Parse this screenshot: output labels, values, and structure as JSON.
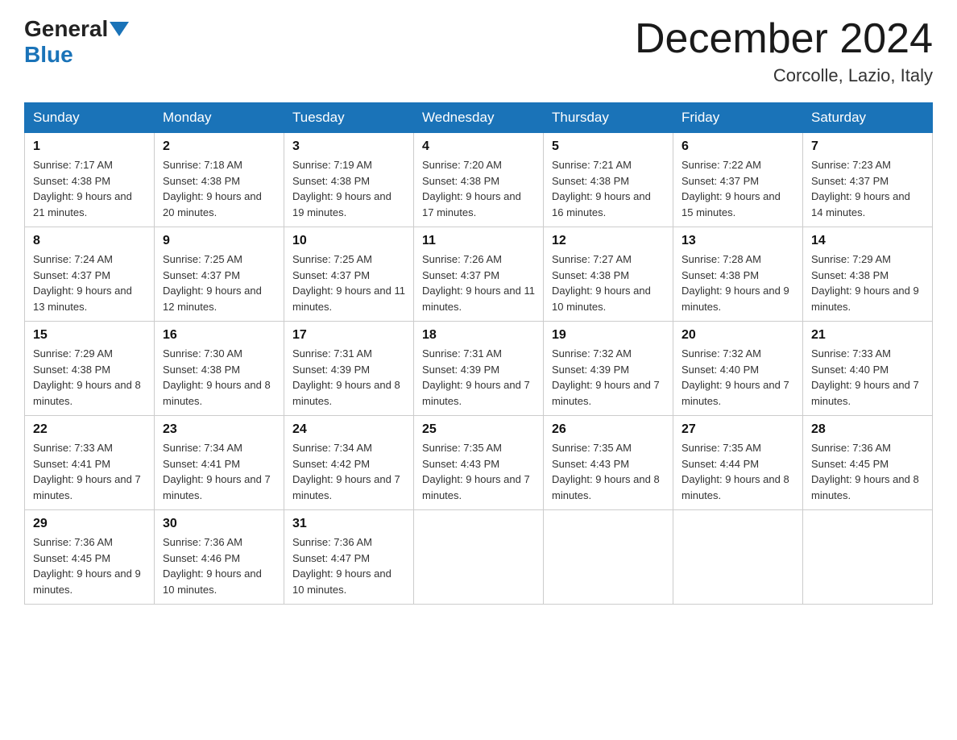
{
  "header": {
    "logo": {
      "general": "General",
      "blue": "Blue"
    },
    "title": "December 2024",
    "location": "Corcolle, Lazio, Italy"
  },
  "days_of_week": [
    "Sunday",
    "Monday",
    "Tuesday",
    "Wednesday",
    "Thursday",
    "Friday",
    "Saturday"
  ],
  "weeks": [
    [
      {
        "day": "1",
        "sunrise": "7:17 AM",
        "sunset": "4:38 PM",
        "daylight": "9 hours and 21 minutes."
      },
      {
        "day": "2",
        "sunrise": "7:18 AM",
        "sunset": "4:38 PM",
        "daylight": "9 hours and 20 minutes."
      },
      {
        "day": "3",
        "sunrise": "7:19 AM",
        "sunset": "4:38 PM",
        "daylight": "9 hours and 19 minutes."
      },
      {
        "day": "4",
        "sunrise": "7:20 AM",
        "sunset": "4:38 PM",
        "daylight": "9 hours and 17 minutes."
      },
      {
        "day": "5",
        "sunrise": "7:21 AM",
        "sunset": "4:38 PM",
        "daylight": "9 hours and 16 minutes."
      },
      {
        "day": "6",
        "sunrise": "7:22 AM",
        "sunset": "4:37 PM",
        "daylight": "9 hours and 15 minutes."
      },
      {
        "day": "7",
        "sunrise": "7:23 AM",
        "sunset": "4:37 PM",
        "daylight": "9 hours and 14 minutes."
      }
    ],
    [
      {
        "day": "8",
        "sunrise": "7:24 AM",
        "sunset": "4:37 PM",
        "daylight": "9 hours and 13 minutes."
      },
      {
        "day": "9",
        "sunrise": "7:25 AM",
        "sunset": "4:37 PM",
        "daylight": "9 hours and 12 minutes."
      },
      {
        "day": "10",
        "sunrise": "7:25 AM",
        "sunset": "4:37 PM",
        "daylight": "9 hours and 11 minutes."
      },
      {
        "day": "11",
        "sunrise": "7:26 AM",
        "sunset": "4:37 PM",
        "daylight": "9 hours and 11 minutes."
      },
      {
        "day": "12",
        "sunrise": "7:27 AM",
        "sunset": "4:38 PM",
        "daylight": "9 hours and 10 minutes."
      },
      {
        "day": "13",
        "sunrise": "7:28 AM",
        "sunset": "4:38 PM",
        "daylight": "9 hours and 9 minutes."
      },
      {
        "day": "14",
        "sunrise": "7:29 AM",
        "sunset": "4:38 PM",
        "daylight": "9 hours and 9 minutes."
      }
    ],
    [
      {
        "day": "15",
        "sunrise": "7:29 AM",
        "sunset": "4:38 PM",
        "daylight": "9 hours and 8 minutes."
      },
      {
        "day": "16",
        "sunrise": "7:30 AM",
        "sunset": "4:38 PM",
        "daylight": "9 hours and 8 minutes."
      },
      {
        "day": "17",
        "sunrise": "7:31 AM",
        "sunset": "4:39 PM",
        "daylight": "9 hours and 8 minutes."
      },
      {
        "day": "18",
        "sunrise": "7:31 AM",
        "sunset": "4:39 PM",
        "daylight": "9 hours and 7 minutes."
      },
      {
        "day": "19",
        "sunrise": "7:32 AM",
        "sunset": "4:39 PM",
        "daylight": "9 hours and 7 minutes."
      },
      {
        "day": "20",
        "sunrise": "7:32 AM",
        "sunset": "4:40 PM",
        "daylight": "9 hours and 7 minutes."
      },
      {
        "day": "21",
        "sunrise": "7:33 AM",
        "sunset": "4:40 PM",
        "daylight": "9 hours and 7 minutes."
      }
    ],
    [
      {
        "day": "22",
        "sunrise": "7:33 AM",
        "sunset": "4:41 PM",
        "daylight": "9 hours and 7 minutes."
      },
      {
        "day": "23",
        "sunrise": "7:34 AM",
        "sunset": "4:41 PM",
        "daylight": "9 hours and 7 minutes."
      },
      {
        "day": "24",
        "sunrise": "7:34 AM",
        "sunset": "4:42 PM",
        "daylight": "9 hours and 7 minutes."
      },
      {
        "day": "25",
        "sunrise": "7:35 AM",
        "sunset": "4:43 PM",
        "daylight": "9 hours and 7 minutes."
      },
      {
        "day": "26",
        "sunrise": "7:35 AM",
        "sunset": "4:43 PM",
        "daylight": "9 hours and 8 minutes."
      },
      {
        "day": "27",
        "sunrise": "7:35 AM",
        "sunset": "4:44 PM",
        "daylight": "9 hours and 8 minutes."
      },
      {
        "day": "28",
        "sunrise": "7:36 AM",
        "sunset": "4:45 PM",
        "daylight": "9 hours and 8 minutes."
      }
    ],
    [
      {
        "day": "29",
        "sunrise": "7:36 AM",
        "sunset": "4:45 PM",
        "daylight": "9 hours and 9 minutes."
      },
      {
        "day": "30",
        "sunrise": "7:36 AM",
        "sunset": "4:46 PM",
        "daylight": "9 hours and 10 minutes."
      },
      {
        "day": "31",
        "sunrise": "7:36 AM",
        "sunset": "4:47 PM",
        "daylight": "9 hours and 10 minutes."
      },
      null,
      null,
      null,
      null
    ]
  ]
}
